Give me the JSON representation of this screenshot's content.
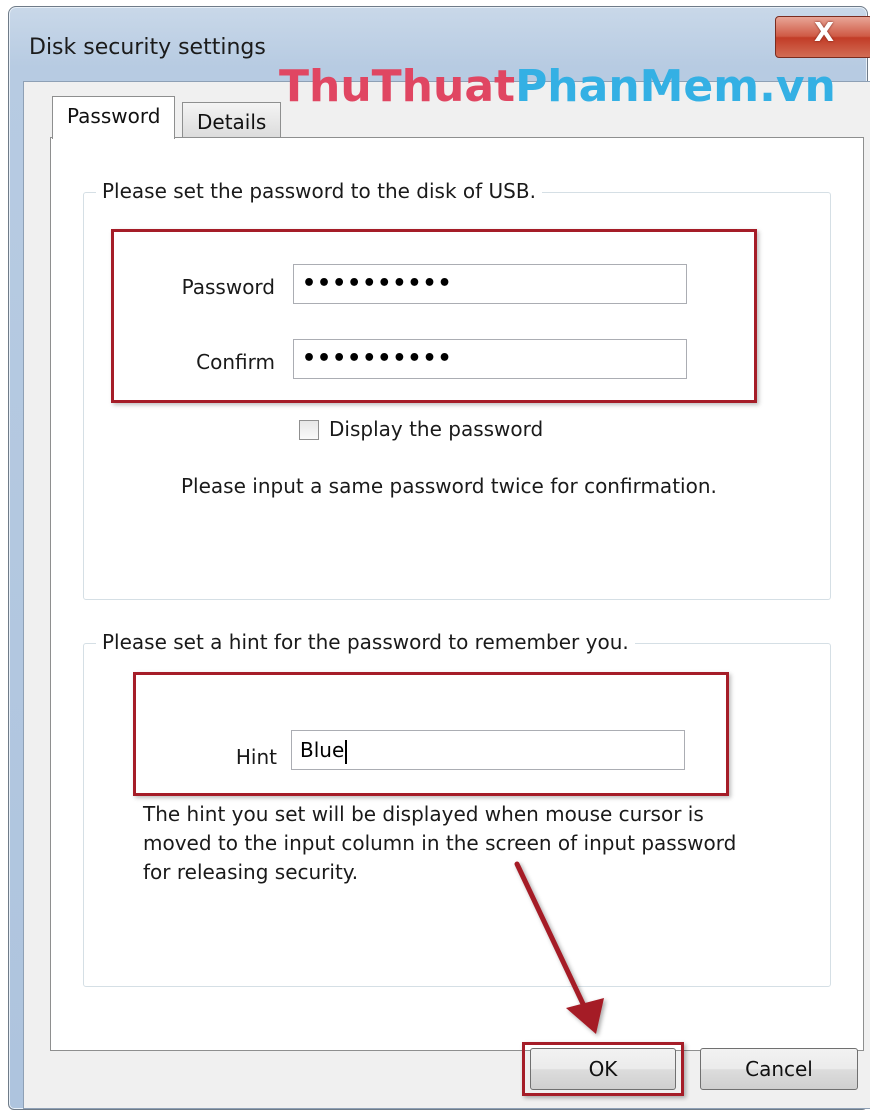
{
  "window": {
    "title": "Disk security settings",
    "close_glyph": "X"
  },
  "watermark": {
    "part1": "ThuThuat",
    "part2": "PhanMem.vn"
  },
  "tabs": [
    {
      "label": "Password",
      "selected": true
    },
    {
      "label": "Details",
      "selected": false
    }
  ],
  "password_group": {
    "title": "Please set the password to the disk of USB.",
    "password_label": "Password",
    "password_value": "••••••••••",
    "confirm_label": "Confirm",
    "confirm_value": "••••••••••",
    "display_checkbox_label": "Display the password",
    "display_checked": false,
    "instruction": "Please input a same password twice for confirmation."
  },
  "hint_group": {
    "title": "Please set a hint for the password to remember you.",
    "hint_label": "Hint",
    "hint_value": "Blue",
    "description_line1": "The hint you set will be displayed when mouse cursor is",
    "description_line2": "moved to the input column in the screen of input password",
    "description_line3": "for releasing security."
  },
  "buttons": {
    "ok_label": "OK",
    "cancel_label": "Cancel"
  },
  "colors": {
    "annotation_red": "#a51d28",
    "watermark_pink": "#e04662",
    "watermark_blue": "#34b0e4"
  },
  "icons": {
    "close": "close-icon",
    "arrow": "annotation-arrow-icon"
  }
}
